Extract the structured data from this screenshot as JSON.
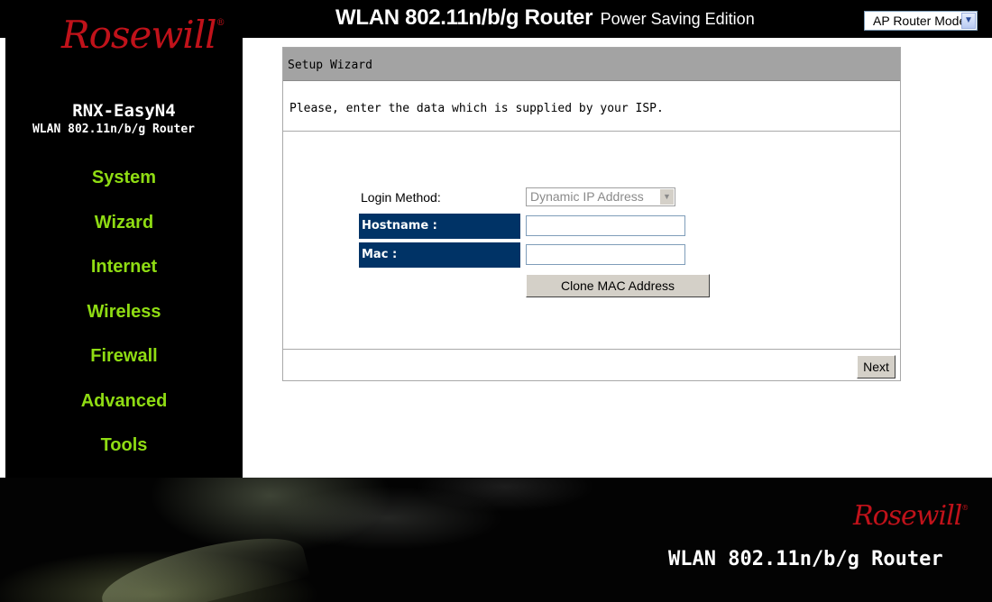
{
  "header": {
    "title_main": "WLAN 802.11n/b/g Router",
    "title_sub": "Power Saving Edition",
    "mode_select": {
      "value": "AP Router Mode",
      "arrow_icon": "chevron-down-icon"
    }
  },
  "sidebar": {
    "logo_text": "Rosewill",
    "logo_reg": "®",
    "model": "RNX-EasyN4",
    "model_sub": "WLAN 802.11n/b/g Router",
    "nav": [
      {
        "label": "System"
      },
      {
        "label": "Wizard"
      },
      {
        "label": "Internet"
      },
      {
        "label": "Wireless"
      },
      {
        "label": "Firewall"
      },
      {
        "label": "Advanced"
      },
      {
        "label": "Tools"
      }
    ],
    "nav_color": "#8fdc13"
  },
  "panel": {
    "title": "Setup Wizard",
    "description": "Please, enter the data which is supplied by your ISP.",
    "login_method": {
      "label": "Login Method:",
      "value": "Dynamic IP Address"
    },
    "hostname": {
      "label": "Hostname :",
      "value": ""
    },
    "mac": {
      "label": "Mac :",
      "value": ""
    },
    "clone_button": "Clone MAC Address",
    "next_button": "Next",
    "label_bg_color": "#003366"
  },
  "footer": {
    "logo_text": "Rosewill",
    "logo_reg": "®",
    "product": "WLAN 802.11n/b/g Router"
  }
}
